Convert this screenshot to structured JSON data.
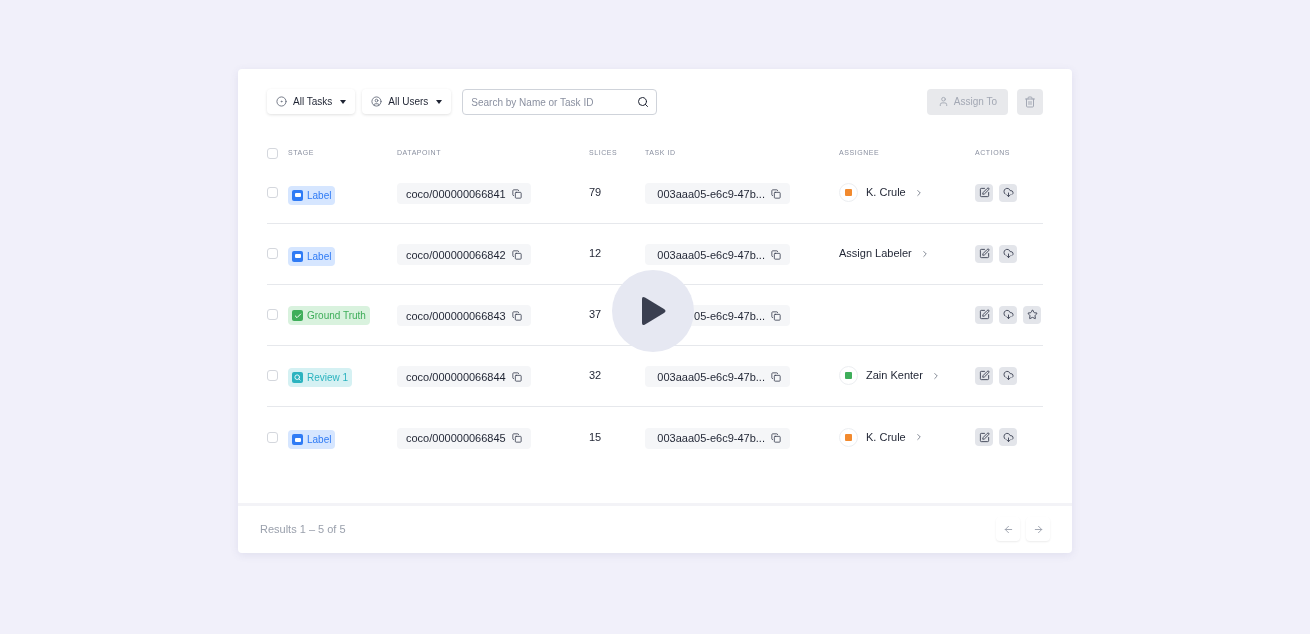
{
  "toolbar": {
    "filters": [
      {
        "label": "All Tasks"
      },
      {
        "label": "All Users"
      }
    ],
    "search": {
      "placeholder": "Search by Name or Task ID"
    },
    "assign_button": {
      "label": "Assign To",
      "disabled": true
    },
    "delete_button": {
      "disabled": true
    }
  },
  "table": {
    "columns": [
      "STAGE",
      "DATAPOINT",
      "SLICES",
      "TASK ID",
      "ASSIGNEE",
      "ACTIONS"
    ],
    "header_checked": false,
    "rows": [
      {
        "checked": false,
        "stage": {
          "label": "Label",
          "kind": "label"
        },
        "datapoint": "coco/000000066841",
        "slices": "79",
        "task_id": "003aaa05-e6c9-47b...",
        "assignee": {
          "name": "K. Crule",
          "kind": "orange_avatar"
        },
        "actions": [
          {
            "kind": "edit"
          },
          {
            "kind": "download"
          }
        ]
      },
      {
        "checked": false,
        "stage": {
          "label": "Label",
          "kind": "label"
        },
        "datapoint": "coco/000000066842",
        "slices": "12",
        "task_id": "003aaa05-e6c9-47b...",
        "assignee": {
          "name": "Assign Labeler",
          "kind": "unassigned"
        },
        "actions": [
          {
            "kind": "edit"
          },
          {
            "kind": "download"
          }
        ]
      },
      {
        "checked": false,
        "stage": {
          "label": "Ground Truth",
          "kind": "ground_truth"
        },
        "datapoint": "coco/000000066843",
        "slices": "37",
        "task_id": "05-e6c9-47b...",
        "actions": [
          {
            "kind": "edit"
          },
          {
            "kind": "download"
          },
          {
            "kind": "star"
          }
        ]
      },
      {
        "checked": false,
        "stage": {
          "label": "Review 1",
          "kind": "review"
        },
        "datapoint": "coco/000000066844",
        "slices": "32",
        "task_id": "003aaa05-e6c9-47b...",
        "assignee": {
          "name": "Zain Kenter",
          "kind": "green_avatar"
        },
        "actions": [
          {
            "kind": "edit"
          },
          {
            "kind": "download"
          }
        ]
      },
      {
        "checked": false,
        "stage": {
          "label": "Label",
          "kind": "label"
        },
        "datapoint": "coco/000000066845",
        "slices": "15",
        "task_id": "003aaa05-e6c9-47b...",
        "assignee": {
          "name": "K. Crule",
          "kind": "orange_avatar"
        },
        "actions": [
          {
            "kind": "edit"
          },
          {
            "kind": "download"
          }
        ]
      }
    ]
  },
  "footer": {
    "results": "Results 1 – 5 of 5"
  }
}
